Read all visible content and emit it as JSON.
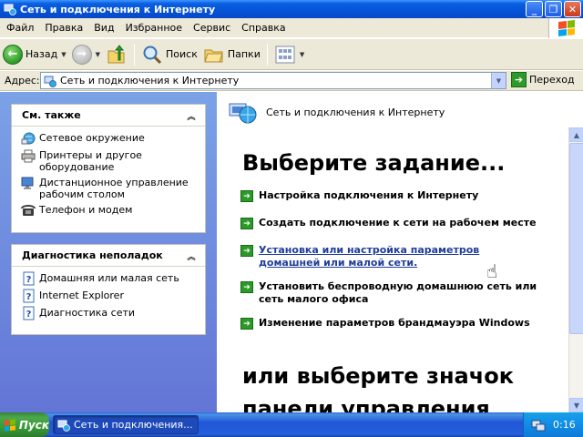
{
  "window": {
    "title": "Сеть и подключения к Интернету"
  },
  "menu": [
    "Файл",
    "Правка",
    "Вид",
    "Избранное",
    "Сервис",
    "Справка"
  ],
  "toolbar": {
    "back": "Назад",
    "search": "Поиск",
    "folders": "Папки"
  },
  "address": {
    "label": "Адрес:",
    "value": "Сеть и подключения к Интернету",
    "go": "Переход"
  },
  "see_also": {
    "title": "См. также",
    "items": [
      "Сетевое окружение",
      "Принтеры и другое оборудование",
      "Дистанционное управление рабочим столом",
      "Телефон и модем"
    ]
  },
  "troubleshoot": {
    "title": "Диагностика неполадок",
    "items": [
      "Домашняя или малая сеть",
      "Internet Explorer",
      "Диагностика сети"
    ]
  },
  "content": {
    "header": "Сеть и подключения к Интернету",
    "pick_task": "Выберите задание...",
    "tasks": [
      "Настройка подключения к Интернету",
      "Создать подключение к сети на рабочем месте",
      "Установка или настройка параметров домашней или малой сети.",
      "Установить беспроводную домашнюю сеть или сеть малого офиса",
      "Изменение параметров брандмауэра Windows"
    ],
    "or_pick_icon": "или выберите значок",
    "control_panel": "панели управления"
  },
  "taskbar": {
    "start": "Пуск",
    "task_item": "Сеть и подключения...",
    "clock": "0:16"
  },
  "colors": {
    "xp_blue": "#0553d8",
    "task_green": "#2c9a28",
    "link_blue": "#1f3d9a"
  }
}
